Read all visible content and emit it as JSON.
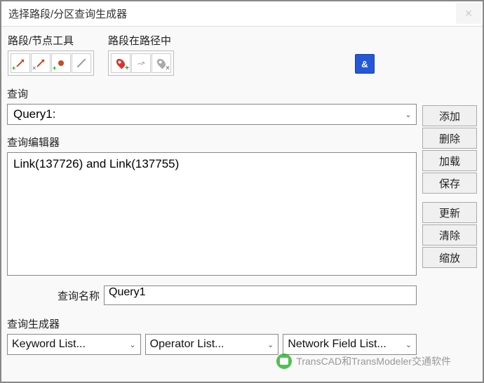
{
  "title": "选择路段/分区查询生成器",
  "toolgroups": {
    "link_node": {
      "label": "路段/节点工具"
    },
    "on_path": {
      "label": "路段在路径中"
    }
  },
  "and_label": "&",
  "query_section": {
    "label": "查询",
    "value": "Query1:"
  },
  "editor_section": {
    "label": "查询编辑器",
    "content": "Link(137726) and Link(137755)"
  },
  "query_name": {
    "label": "查询名称",
    "value": "Query1"
  },
  "builder": {
    "label": "查询生成器",
    "keyword": "Keyword List...",
    "operator": "Operator List...",
    "field": "Network Field List..."
  },
  "buttons": {
    "add": "添加",
    "delete": "删除",
    "load": "加载",
    "save": "保存",
    "update": "更新",
    "clear": "清除",
    "zoom": "缩放"
  },
  "watermark": "TransCAD和TransModeler交通软件"
}
